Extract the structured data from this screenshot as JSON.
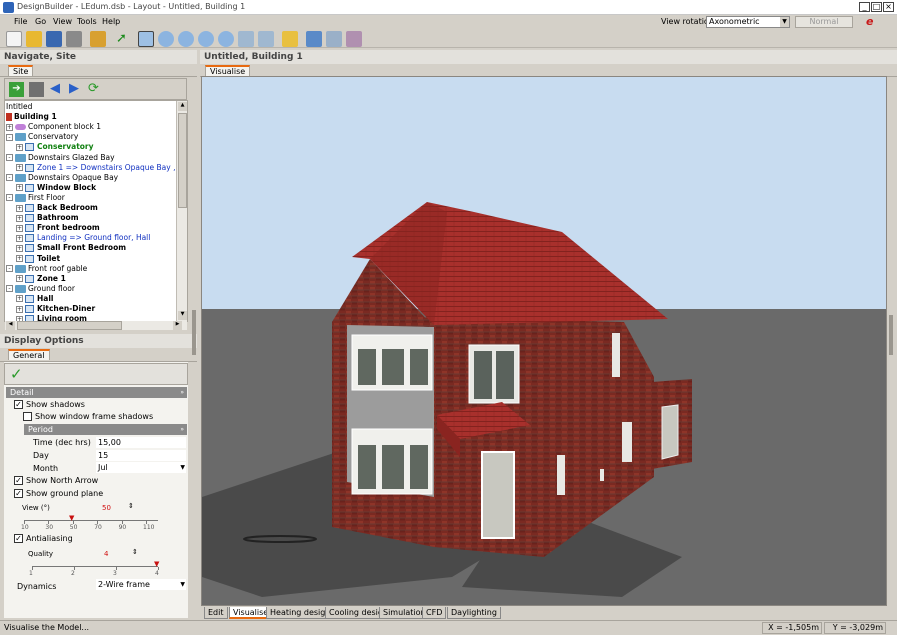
{
  "window": {
    "title": "DesignBuilder - LEdum.dsb - Layout - Untitled, Building 1"
  },
  "menu": [
    "File",
    "Go",
    "View",
    "Tools",
    "Help"
  ],
  "view_rotation": {
    "label": "View rotation",
    "value": "Axonometric",
    "mode_button": "Normal"
  },
  "toolbar_icons": [
    "new-file-icon",
    "open-folder-icon",
    "save-icon",
    "print-icon",
    "wrench-icon",
    "pointer-icon",
    "orbit-icon",
    "zoom-in-icon",
    "zoom-out-icon",
    "zoom-fit-icon",
    "pan-icon",
    "measure-icon",
    "camera-icon",
    "settings-icon",
    "layers-icon",
    "object-icon",
    "grid-icon"
  ],
  "navigate": {
    "header": "Navigate, Site",
    "tab": "Site",
    "tree": [
      {
        "label": "Intitled",
        "depth": 0,
        "style": "plain",
        "icon": "none",
        "expand": ""
      },
      {
        "label": "Building 1",
        "depth": 0,
        "style": "bold",
        "icon": "building",
        "expand": ""
      },
      {
        "label": "Component block 1",
        "depth": 0,
        "style": "plain",
        "icon": "component",
        "expand": "+"
      },
      {
        "label": "Conservatory",
        "depth": 0,
        "style": "plain",
        "icon": "block",
        "expand": "-"
      },
      {
        "label": "Conservatory",
        "depth": 1,
        "style": "green",
        "icon": "zone",
        "expand": "+"
      },
      {
        "label": "Downstairs Glazed Bay",
        "depth": 0,
        "style": "plain",
        "icon": "block",
        "expand": "-"
      },
      {
        "label": "Zone 1 => Downstairs Opaque Bay , Window B",
        "depth": 1,
        "style": "blue",
        "icon": "zone",
        "expand": "+"
      },
      {
        "label": "Downstairs Opaque Bay",
        "depth": 0,
        "style": "plain",
        "icon": "block",
        "expand": "-"
      },
      {
        "label": "Window Block",
        "depth": 1,
        "style": "bold",
        "icon": "zone",
        "expand": "+"
      },
      {
        "label": "First Floor",
        "depth": 0,
        "style": "plain",
        "icon": "block",
        "expand": "-"
      },
      {
        "label": "Back Bedroom",
        "depth": 1,
        "style": "bold",
        "icon": "zone",
        "expand": "+"
      },
      {
        "label": "Bathroom",
        "depth": 1,
        "style": "bold",
        "icon": "zone",
        "expand": "+"
      },
      {
        "label": "Front bedroom",
        "depth": 1,
        "style": "bold",
        "icon": "zone",
        "expand": "+"
      },
      {
        "label": "Landing => Ground floor, Hall",
        "depth": 1,
        "style": "blue",
        "icon": "zone",
        "expand": "+"
      },
      {
        "label": "Small Front Bedroom",
        "depth": 1,
        "style": "bold",
        "icon": "zone",
        "expand": "+"
      },
      {
        "label": "Toilet",
        "depth": 1,
        "style": "bold",
        "icon": "zone",
        "expand": "+"
      },
      {
        "label": "Front roof gable",
        "depth": 0,
        "style": "plain",
        "icon": "block",
        "expand": "-"
      },
      {
        "label": "Zone 1",
        "depth": 1,
        "style": "bold",
        "icon": "zone",
        "expand": "+"
      },
      {
        "label": "Ground floor",
        "depth": 0,
        "style": "plain",
        "icon": "block",
        "expand": "-"
      },
      {
        "label": "Hall",
        "depth": 1,
        "style": "bold",
        "icon": "zone",
        "expand": "+"
      },
      {
        "label": "Kitchen-Diner",
        "depth": 1,
        "style": "bold",
        "icon": "zone",
        "expand": "+"
      },
      {
        "label": "Living room",
        "depth": 1,
        "style": "bold",
        "icon": "zone",
        "expand": "+"
      }
    ]
  },
  "display": {
    "header": "Display Options",
    "tab": "General",
    "group_detail": "Detail",
    "show_shadows": "Show shadows",
    "show_window_frame_shadows": "Show window frame shadows",
    "group_period": "Period",
    "time_label": "Time (dec hrs)",
    "time_value": "15,00",
    "day_label": "Day",
    "day_value": "15",
    "month_label": "Month",
    "month_value": "Jul",
    "show_north_arrow": "Show North Arrow",
    "show_ground_plane": "Show ground plane",
    "view_label": "View (°)",
    "view_value": "50",
    "view_ticks": [
      "10",
      "30",
      "50",
      "70",
      "90",
      "110"
    ],
    "antialiasing": "Antialiasing",
    "quality_label": "Quality",
    "quality_value": "4",
    "quality_ticks": [
      "1",
      "2",
      "3",
      "4"
    ],
    "dynamics_label": "Dynamics",
    "dynamics_value": "2-Wire frame",
    "checks": {
      "show_shadows": true,
      "show_window_frame_shadows": false,
      "show_north_arrow": true,
      "show_ground_plane": true,
      "antialiasing": true
    }
  },
  "viewport": {
    "header": "Untitled, Building 1",
    "tab": "Visualise"
  },
  "bottom_tabs": [
    "Edit",
    "Visualise",
    "Heating design",
    "Cooling design",
    "Simulation",
    "CFD",
    "Daylighting"
  ],
  "active_bottom_tab": "Visualise",
  "status": {
    "message": "Visualise the Model...",
    "x": "X = -1,505m",
    "y": "Y = -3,029m"
  },
  "colors": {
    "sky": "#c8dcf0",
    "ground": "#6a6a6a",
    "brick": "#7a2a22",
    "roof": "#a8302c",
    "accent_tab": "#e86a10"
  }
}
